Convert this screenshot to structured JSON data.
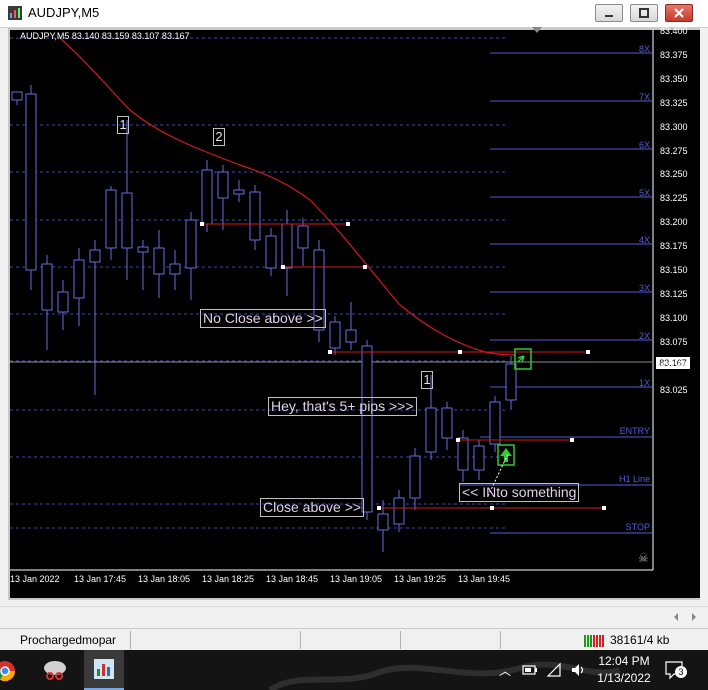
{
  "window": {
    "title": "AUDJPY,M5"
  },
  "chart": {
    "header": "AUDJPY,M5  83.140 83.159 83.107 83.167",
    "price_axis": [
      "83.400",
      "83.375",
      "83.350",
      "83.325",
      "83.300",
      "83.275",
      "83.250",
      "83.225",
      "83.200",
      "83.175",
      "83.150",
      "83.125",
      "83.100",
      "83.075",
      "83.050",
      "83.025"
    ],
    "current_price": "83.167",
    "time_axis": [
      "13 Jan 2022",
      "13 Jan 17:45",
      "13 Jan 18:05",
      "13 Jan 18:25",
      "13 Jan 18:45",
      "13 Jan 19:05",
      "13 Jan 19:25",
      "13 Jan 19:45"
    ],
    "levels": [
      "8X",
      "7X",
      "6X",
      "5X",
      "4X",
      "3X",
      "2X",
      "1X",
      "ENTRY",
      "H1 Line",
      "STOP"
    ],
    "annotations": {
      "no_close": "No Close above >>",
      "five_pips": "Hey, that's 5+ pips >>>",
      "close_above": "Close above >>",
      "into_something": "<< INto something"
    },
    "markers": [
      "1",
      "2",
      "1"
    ],
    "colors": {
      "level": "#4e5fd8",
      "ma": "#d41a1a",
      "candle": "#6a6ae0",
      "background": "#000000"
    }
  },
  "status": {
    "profile": "Prochargedmopar",
    "traffic": "38161/4 kb"
  },
  "taskbar": {
    "time": "12:04 PM",
    "date": "1/13/2022",
    "notifications": "3"
  }
}
